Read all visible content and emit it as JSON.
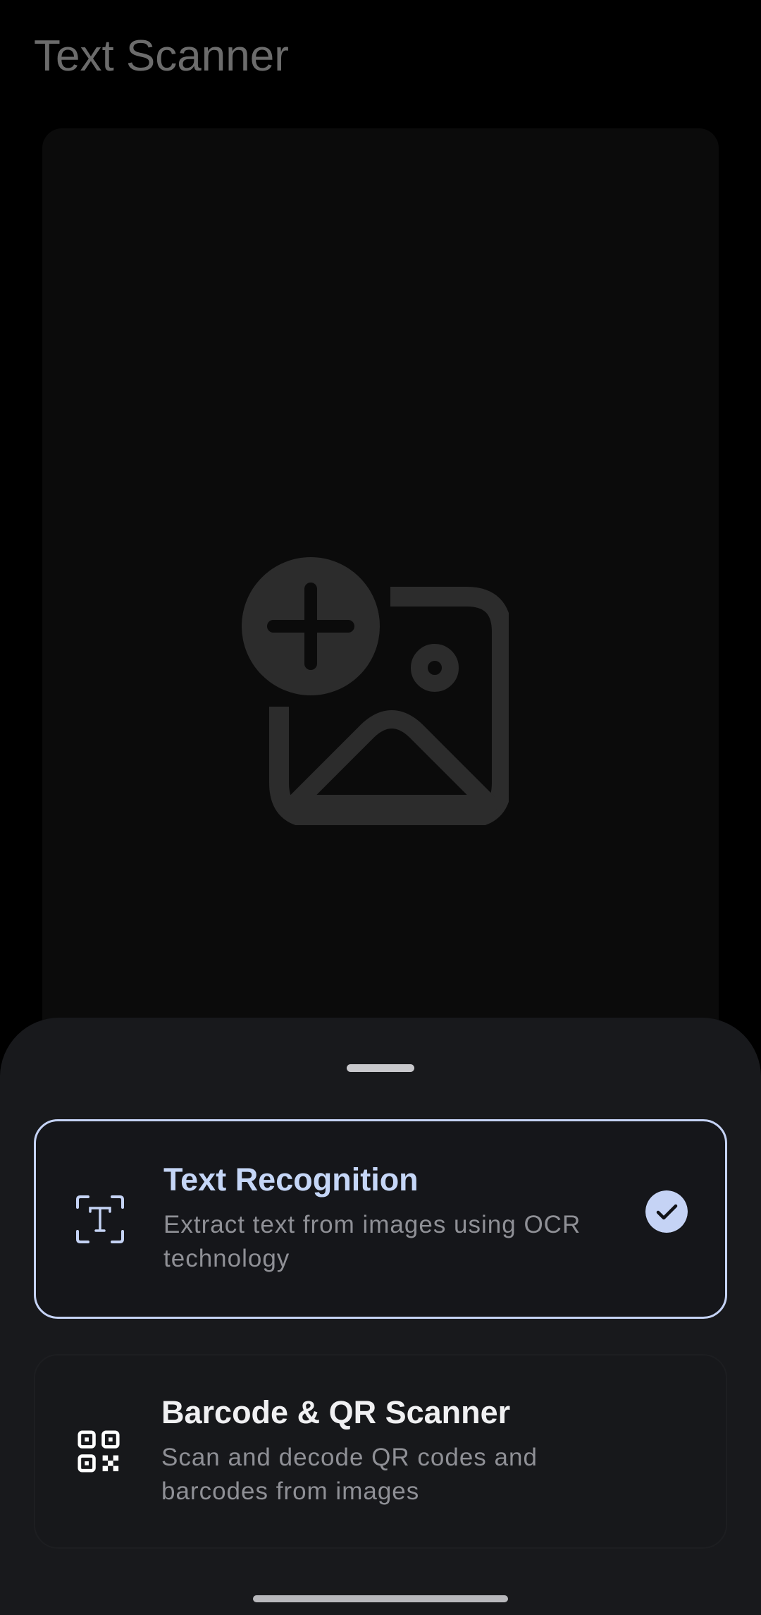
{
  "header": {
    "title": "Text Scanner"
  },
  "drop_zone": {
    "icon": "add-photo-icon"
  },
  "bottom_sheet": {
    "modes": [
      {
        "title": "Text Recognition",
        "description": "Extract text from images using OCR technology",
        "icon": "text-recognition-icon",
        "selected": true
      },
      {
        "title": "Barcode & QR Scanner",
        "description": "Scan and decode QR codes and barcodes from images",
        "icon": "qr-code-icon",
        "selected": false
      }
    ]
  },
  "colors": {
    "background": "#000000",
    "sheet": "#18191c",
    "accent": "#c5d3f5",
    "selected_title": "#c5d6f7",
    "title_muted": "#6c6c6c"
  }
}
